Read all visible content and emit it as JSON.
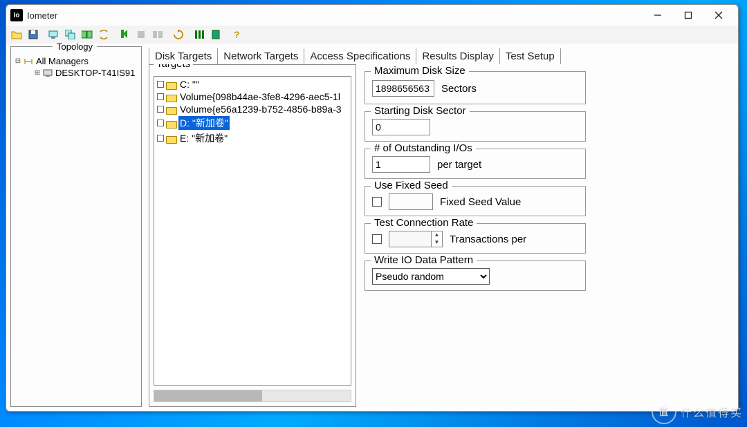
{
  "app": {
    "title": "Iometer",
    "icon_text": "Io"
  },
  "topology": {
    "caption": "Topology",
    "root": "All Managers",
    "child": "DESKTOP-T41IS91"
  },
  "tabs": {
    "disk": "Disk Targets",
    "network": "Network Targets",
    "access": "Access Specifications",
    "results": "Results Display",
    "setup": "Test Setup"
  },
  "targets": {
    "caption": "Targets",
    "items": [
      "C: \"\"",
      "Volume{098b44ae-3fe8-4296-aec5-1l",
      "Volume{e56a1239-b752-4856-b89a-3",
      "D: \"新加卷\"",
      "E: \"新加卷\""
    ],
    "selected_index": 3
  },
  "settings": {
    "max_disk": {
      "caption": "Maximum Disk Size",
      "value": "1898656563",
      "unit": "Sectors"
    },
    "start_sector": {
      "caption": "Starting Disk Sector",
      "value": "0"
    },
    "outstanding": {
      "caption": "# of Outstanding I/Os",
      "value": "1",
      "unit": "per target"
    },
    "fixed_seed": {
      "caption": "Use Fixed Seed",
      "value": "",
      "label": "Fixed Seed Value"
    },
    "conn_rate": {
      "caption": "Test Connection Rate",
      "value": "",
      "label": "Transactions per"
    },
    "write_pattern": {
      "caption": "Write IO Data Pattern",
      "value": "Pseudo random"
    }
  },
  "watermark": "什么值得买"
}
